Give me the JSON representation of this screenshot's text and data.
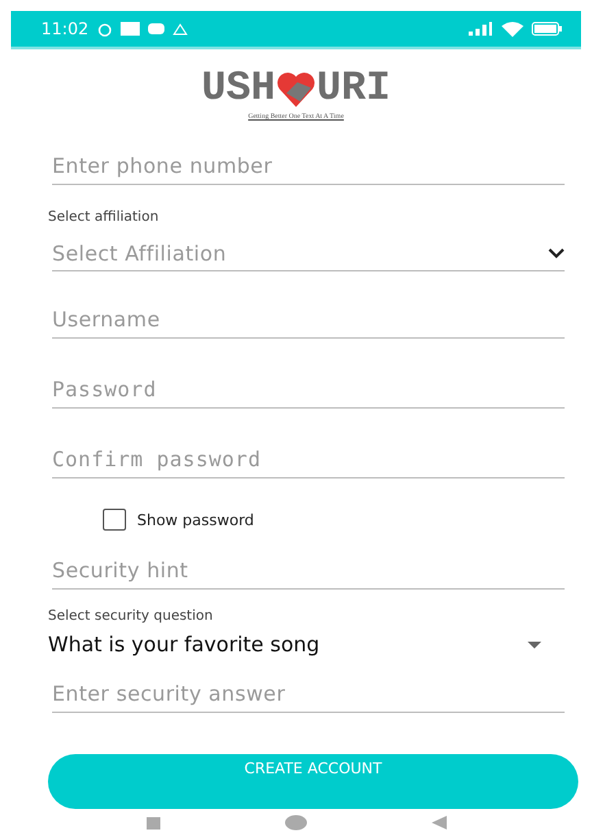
{
  "status_bar": {
    "time": "11:02"
  },
  "logo": {
    "left": "USH",
    "right": "URI",
    "tagline": "Getting Better One Text At A Time"
  },
  "fields": [
    {
      "kind": "text",
      "placeholder": "Enter phone number"
    },
    {
      "kind": "label",
      "text": "Select affiliation"
    },
    {
      "kind": "select",
      "placeholder": "Select Affiliation"
    },
    {
      "kind": "text",
      "placeholder": "Username"
    },
    {
      "kind": "mono",
      "placeholder": "Password"
    },
    {
      "kind": "mono",
      "placeholder": "Confirm password"
    },
    {
      "kind": "checkbox",
      "label": "Show password",
      "checked": false
    },
    {
      "kind": "text",
      "placeholder": "Security hint"
    },
    {
      "kind": "label",
      "text": "Select security question"
    },
    {
      "kind": "spinner",
      "value": "What is your favorite song"
    },
    {
      "kind": "text",
      "placeholder": "Enter security answer"
    }
  ],
  "button": {
    "label": "CREATE ACCOUNT"
  }
}
